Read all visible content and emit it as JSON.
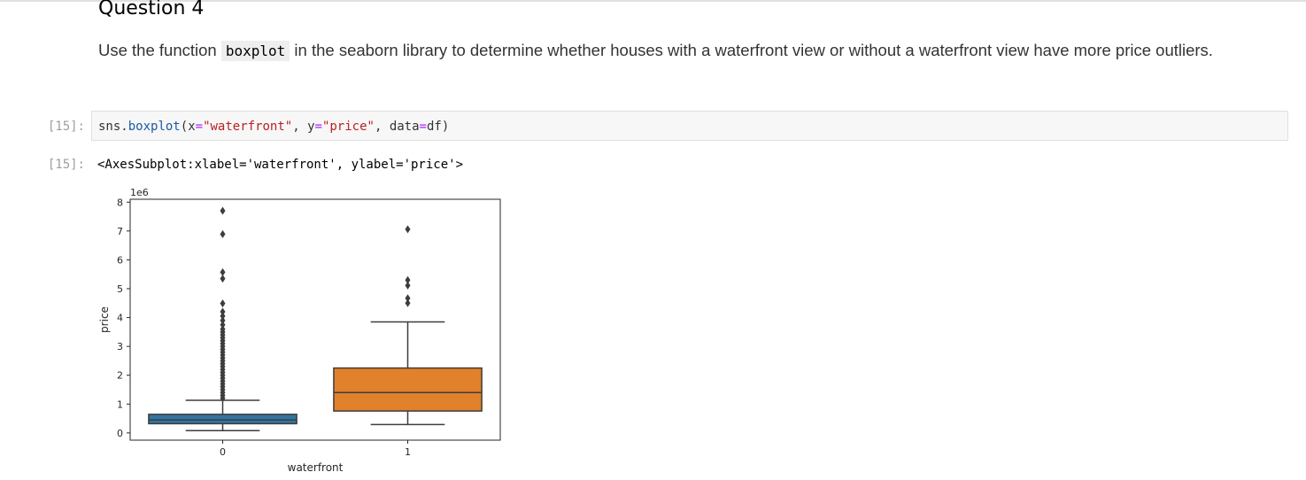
{
  "notebook": {
    "heading": "Question 4",
    "instruction_before": "Use the function ",
    "instruction_code": "boxplot",
    "instruction_after": " in the seaborn library to determine whether houses with a waterfront view or without a waterfront view have more price outliers.",
    "input_prompt": "[15]:",
    "output_prompt": "[15]:",
    "code": {
      "obj": "sns",
      "dot": ".",
      "fn": "boxplot",
      "open": "(",
      "arg1_name": "x",
      "arg1_value": "\"waterfront\"",
      "sep1": ", ",
      "arg2_name": "y",
      "arg2_value": "\"price\"",
      "sep2": ", ",
      "arg3_name": "data",
      "arg3_value": "df",
      "close": ")",
      "eq": "="
    },
    "output_repr": "<AxesSubplot:xlabel='waterfront', ylabel='price'>"
  },
  "chart_data": {
    "type": "box",
    "xlabel": "waterfront",
    "ylabel": "price",
    "offset_label": "1e6",
    "categories": [
      "0",
      "1"
    ],
    "ylim": [
      -0.25,
      8.1
    ],
    "yticks": [
      0,
      1,
      2,
      3,
      4,
      5,
      6,
      7,
      8
    ],
    "y_multiplier": 1000000,
    "series": [
      {
        "category": "0",
        "color": "#3274a1",
        "whisker_low": 0.08,
        "q1": 0.32,
        "median": 0.45,
        "q3": 0.645,
        "whisker_high": 1.13,
        "outliers": [
          7.7,
          6.89,
          5.57,
          5.35,
          4.49,
          4.2,
          4.05,
          3.9,
          3.75,
          3.6,
          3.5,
          3.4,
          3.3,
          3.2,
          3.1,
          3.0,
          2.9,
          2.8,
          2.7,
          2.6,
          2.5,
          2.4,
          2.3,
          2.2,
          2.1,
          2.0,
          1.9,
          1.8,
          1.7,
          1.6,
          1.5,
          1.4,
          1.3,
          1.2
        ]
      },
      {
        "category": "1",
        "color": "#e1812c",
        "whisker_low": 0.29,
        "q1": 0.76,
        "median": 1.4,
        "q3": 2.25,
        "whisker_high": 3.85,
        "outliers": [
          7.06,
          5.3,
          5.11,
          4.67,
          4.5
        ]
      }
    ]
  }
}
